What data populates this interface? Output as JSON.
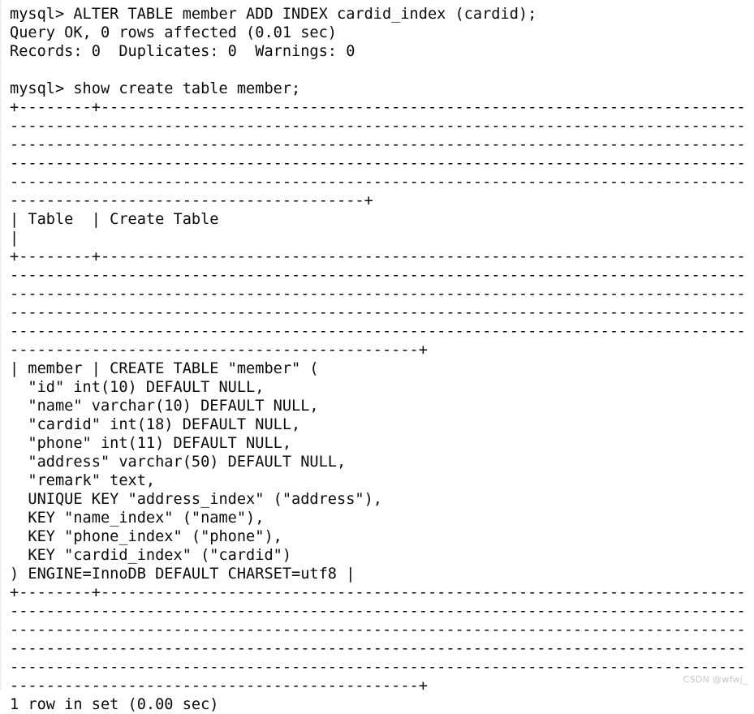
{
  "terminal": {
    "prompt": "mysql>",
    "background_color": "#ffffff",
    "text_color": "#0b0b0b",
    "watermark": "CSDN @wfwj_",
    "separator_fill_char": "-",
    "separator_corner_char": "+",
    "column_separator_char": "|",
    "lines": [
      "mysql> ALTER TABLE member ADD INDEX cardid_index (cardid);",
      "Query OK, 0 rows affected (0.01 sec)",
      "Records: 0  Duplicates: 0  Warnings: 0",
      "",
      "mysql> show create table member;",
      "+--------+--------------------------------------------------------------------------------------------------------------------------------------------------------------------------------------------------------------------------------------------------------------------------------------------------------------------------------------------------------------------------------------------------------------------------------------------------+",
      "| Table  | Create Table                                                                                                                                                                                                                                                                                                                                                                                                                     |",
      "+--------+--------------------------------------------------------------------------------------------------------------------------------------------------------------------------------------------------------------------------------------------------------------------------------------------------------------------------------------------------------------------------------------------------------------------------------------------------------+",
      "| member | CREATE TABLE \"member\" (",
      "  \"id\" int(10) DEFAULT NULL,",
      "  \"name\" varchar(10) DEFAULT NULL,",
      "  \"cardid\" int(18) DEFAULT NULL,",
      "  \"phone\" int(11) DEFAULT NULL,",
      "  \"address\" varchar(50) DEFAULT NULL,",
      "  \"remark\" text,",
      "  UNIQUE KEY \"address_index\" (\"address\"),",
      "  KEY \"name_index\" (\"name\"),",
      "  KEY \"phone_index\" (\"phone\"),",
      "  KEY \"cardid_index\" (\"cardid\")",
      ") ENGINE=InnoDB DEFAULT CHARSET=utf8 |",
      "+--------+--------------------------------------------------------------------------------------------------------------------------------------------------------------------------------------------------------------------------------------------------------------------------------------------------------------------------------------------------------------------------------------------------------------------------------------------------------+",
      "1 row in set (0.00 sec)"
    ],
    "commands": [
      "ALTER TABLE member ADD INDEX cardid_index (cardid);",
      "show create table member;"
    ],
    "results": {
      "alter_status": "Query OK, 0 rows affected (0.01 sec)",
      "alter_records": "Records: 0  Duplicates: 0  Warnings: 0",
      "row_count_status": "1 row in set (0.00 sec)"
    },
    "table": {
      "headers": [
        "Table",
        "Create Table"
      ],
      "row_name": "member",
      "create_statement_lines": [
        "CREATE TABLE \"member\" (",
        "  \"id\" int(10) DEFAULT NULL,",
        "  \"name\" varchar(10) DEFAULT NULL,",
        "  \"cardid\" int(18) DEFAULT NULL,",
        "  \"phone\" int(11) DEFAULT NULL,",
        "  \"address\" varchar(50) DEFAULT NULL,",
        "  \"remark\" text,",
        "  UNIQUE KEY \"address_index\" (\"address\"),",
        "  KEY \"name_index\" (\"name\"),",
        "  KEY \"phone_index\" (\"phone\"),",
        "  KEY \"cardid_index\" (\"cardid\")",
        ") ENGINE=InnoDB DEFAULT CHARSET=utf8"
      ]
    }
  }
}
